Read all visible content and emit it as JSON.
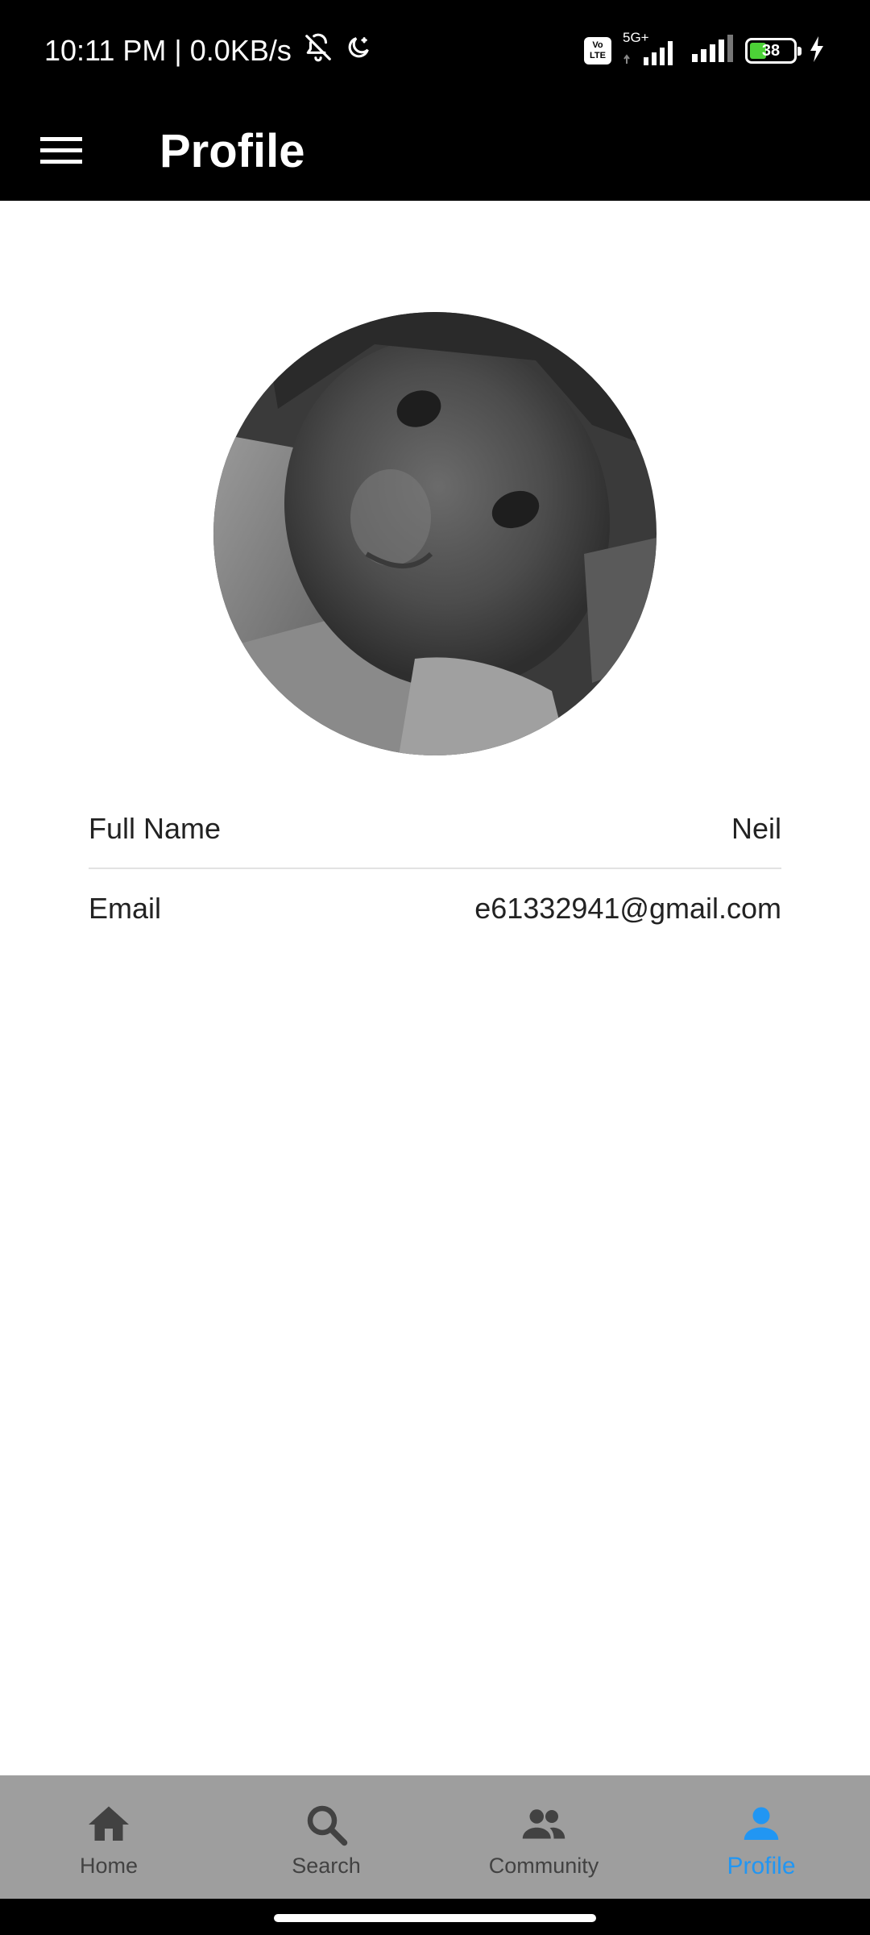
{
  "status_bar": {
    "time_speed": "10:11 PM | 0.0KB/s",
    "volte_top": "Vo",
    "volte_bottom": "LTE",
    "network": "5G+",
    "battery": "38",
    "battery_level": 0.38
  },
  "app_bar": {
    "title": "Profile",
    "menu_icon": "hamburger-menu-icon"
  },
  "profile": {
    "fields": [
      {
        "label": "Full Name",
        "value": "Neil"
      },
      {
        "label": "Email",
        "value": "e61332941@gmail.com"
      }
    ]
  },
  "bottom_nav": {
    "items": [
      {
        "label": "Home",
        "icon": "home-icon"
      },
      {
        "label": "Search",
        "icon": "search-icon"
      },
      {
        "label": "Community",
        "icon": "people-icon"
      },
      {
        "label": "Profile",
        "icon": "person-icon"
      }
    ],
    "active": "Profile"
  },
  "colors": {
    "status_bar_bg": "#000000",
    "app_bar_bg": "#000000",
    "nav_bg": "#9e9e9e",
    "active_accent": "#2196f3",
    "inactive_icon": "#424242"
  }
}
